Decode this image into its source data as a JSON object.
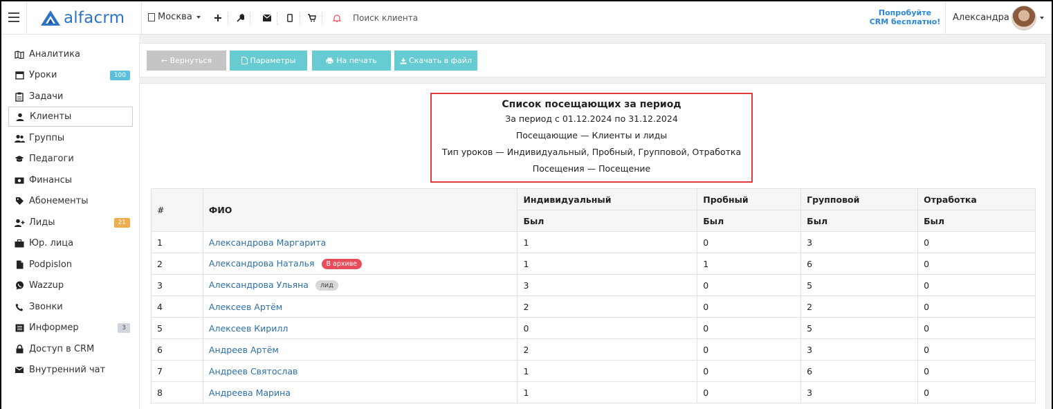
{
  "header": {
    "logo_text": "alfacrm",
    "city": "Москва",
    "search_placeholder": "Поиск клиента",
    "promo_line1": "Попробуйте",
    "promo_line2": "CRM бесплатно!",
    "user_name": "Александра",
    "icons": [
      "plus-icon",
      "wrench-icon",
      "envelope-icon",
      "mobile-icon",
      "cart-icon",
      "bell-icon"
    ],
    "colors": {
      "logo": "#2b74c4",
      "promo": "#2a87d8",
      "bell": "#e74c5b"
    }
  },
  "sidebar": {
    "items": [
      {
        "label": "Аналитика",
        "icon": "map-icon"
      },
      {
        "label": "Уроки",
        "icon": "calendar-icon",
        "badge": "100",
        "badge_color": "#5bc0de"
      },
      {
        "label": "Задачи",
        "icon": "clipboard-icon"
      },
      {
        "label": "Клиенты",
        "icon": "user-icon",
        "active": true
      },
      {
        "label": "Группы",
        "icon": "users-icon"
      },
      {
        "label": "Педагоги",
        "icon": "graduation-cap-icon"
      },
      {
        "label": "Финансы",
        "icon": "money-icon"
      },
      {
        "label": "Абонементы",
        "icon": "tag-icon"
      },
      {
        "label": "Лиды",
        "icon": "user-plus-icon",
        "badge": "21",
        "badge_color": "#f0ad4e"
      },
      {
        "label": "Юр. лица",
        "icon": "briefcase-icon"
      },
      {
        "label": "Podpislon",
        "icon": "file-icon"
      },
      {
        "label": "Wazzup",
        "icon": "whatsapp-icon"
      },
      {
        "label": "Звонки",
        "icon": "phone-icon"
      },
      {
        "label": "Информер",
        "icon": "list-icon",
        "badge": "3",
        "badge_color": "#d0d6dc"
      },
      {
        "label": "Доступ в CRM",
        "icon": "lock-icon"
      },
      {
        "label": "Внутренний чат",
        "icon": "envelope-icon"
      }
    ]
  },
  "toolbar": {
    "back": "← Вернуться",
    "params": "Параметры",
    "print": "На печать",
    "download": "Скачать в файл",
    "colors": {
      "back": "#c5c5c5",
      "teal": "#67ccd2"
    }
  },
  "report": {
    "title": "Список посещающих за период",
    "period": "За период с 01.12.2024 по 31.12.2024",
    "visitors": "Посещающие — Клиенты и лиды",
    "lesson_types": "Тип уроков — Индивидуальный, Пробный, Групповой, Отработка",
    "visits": "Посещения — Посещение",
    "highlight_color": "#e03a3a"
  },
  "table": {
    "col_num": "#",
    "col_name": "ФИО",
    "groups": [
      "Индивидуальный",
      "Пробный",
      "Групповой",
      "Отработка"
    ],
    "sub": "Был",
    "rows": [
      {
        "num": "1",
        "name": "Александрова Маргарита",
        "tag": "",
        "tag_type": "",
        "v": [
          "1",
          "0",
          "3",
          "0"
        ]
      },
      {
        "num": "2",
        "name": "Александрова Наталья",
        "tag": "В архиве",
        "tag_type": "archive",
        "v": [
          "1",
          "1",
          "6",
          "0"
        ]
      },
      {
        "num": "3",
        "name": "Александрова Ульяна",
        "tag": "лид",
        "tag_type": "lead",
        "v": [
          "3",
          "0",
          "5",
          "0"
        ]
      },
      {
        "num": "4",
        "name": "Алексеев Артём",
        "tag": "",
        "tag_type": "",
        "v": [
          "2",
          "0",
          "2",
          "0"
        ]
      },
      {
        "num": "5",
        "name": "Алексеев Кирилл",
        "tag": "",
        "tag_type": "",
        "v": [
          "0",
          "0",
          "5",
          "0"
        ]
      },
      {
        "num": "6",
        "name": "Андреев Артём",
        "tag": "",
        "tag_type": "",
        "v": [
          "2",
          "0",
          "3",
          "0"
        ]
      },
      {
        "num": "7",
        "name": "Андреев Святослав",
        "tag": "",
        "tag_type": "",
        "v": [
          "1",
          "0",
          "6",
          "0"
        ]
      },
      {
        "num": "8",
        "name": "Андреева Марина",
        "tag": "",
        "tag_type": "",
        "v": [
          "1",
          "0",
          "3",
          "0"
        ]
      }
    ]
  }
}
